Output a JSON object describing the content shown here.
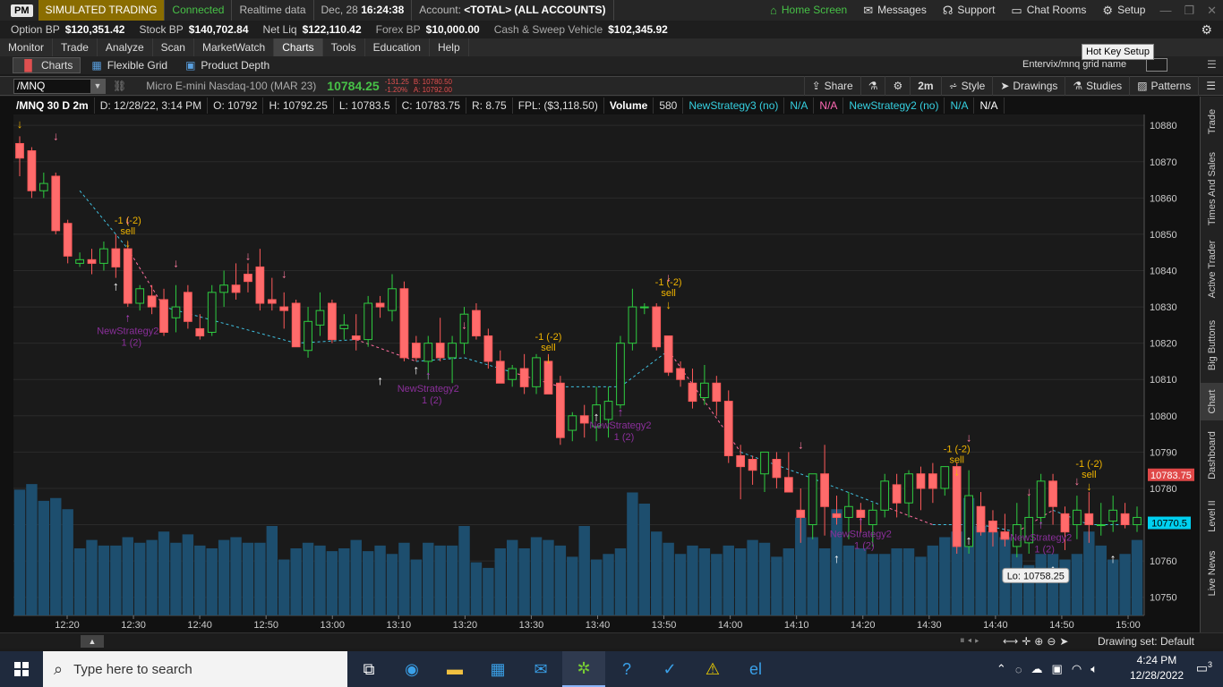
{
  "titlebar": {
    "logo": "PM",
    "mode": "SIMULATED TRADING",
    "status": "Connected",
    "data_feed": "Realtime data",
    "date": "Dec, 28",
    "time": "16:24:38",
    "account_label": "Account:",
    "account_value": "<TOTAL> (ALL ACCOUNTS)",
    "home_screen": "Home Screen",
    "messages": "Messages",
    "support": "Support",
    "chat_rooms": "Chat Rooms",
    "setup": "Setup"
  },
  "balances": [
    {
      "label": "Option BP",
      "value": "$120,351.42"
    },
    {
      "label": "Stock BP",
      "value": "$140,702.84"
    },
    {
      "label": "Net Liq",
      "value": "$122,110.42"
    },
    {
      "label": "Forex BP",
      "value": "$10,000.00"
    },
    {
      "label": "Cash & Sweep Vehicle",
      "value": "$102,345.92"
    }
  ],
  "menu": [
    "Monitor",
    "Trade",
    "Analyze",
    "Scan",
    "MarketWatch",
    "Charts",
    "Tools",
    "Education",
    "Help"
  ],
  "menu_active": "Charts",
  "subtabs": {
    "charts": "Charts",
    "flexible_grid": "Flexible Grid",
    "product_depth": "Product Depth"
  },
  "hotkey_tooltip": "Hot Key Setup",
  "grid_name": "Entervix/mnq grid name",
  "symbol": {
    "ticker": "/MNQ",
    "description": "Micro E-mini Nasdaq-100 (MAR 23)",
    "last": "10784.25",
    "change": "-131.25",
    "change_pct": "-1.20%",
    "bid": "B: 10780.50",
    "ask": "A: 10792.00"
  },
  "chart_toolbar": {
    "share": "Share",
    "timeframe": "2m",
    "style": "Style",
    "drawings": "Drawings",
    "studies": "Studies",
    "patterns": "Patterns"
  },
  "info": {
    "symbol": "/MNQ 30 D 2m",
    "date": "D: 12/28/22, 3:14 PM",
    "open": "O: 10792",
    "high": "H: 10792.25",
    "low": "L: 10783.5",
    "close": "C: 10783.75",
    "range": "R: 8.75",
    "fpl": "FPL: ($3,118.50)",
    "volume_label": "Volume",
    "volume": "580",
    "strategy3": "NewStrategy3 (no)",
    "s3_na1": "N/A",
    "s3_na2": "N/A",
    "strategy2": "NewStrategy2 (no)",
    "s2_na1": "N/A",
    "s2_na2": "N/A"
  },
  "chart_data": {
    "type": "candlestick",
    "price_ticks": [
      "10880",
      "10870",
      "10860",
      "10850",
      "10840",
      "10830",
      "10820",
      "10810",
      "10800",
      "10790",
      "10780",
      "10770",
      "10760",
      "10750"
    ],
    "time_ticks": [
      "12:20",
      "12:30",
      "12:40",
      "12:50",
      "13:00",
      "13:10",
      "13:20",
      "13:30",
      "13:40",
      "13:50",
      "14:00",
      "14:10",
      "14:20",
      "14:30",
      "14:40",
      "14:50",
      "15:00"
    ],
    "last_price_label": "10783.75",
    "cursor_price_label": "10770.5",
    "low_label": "Lo: 10758.25",
    "ylim": [
      10745,
      10883
    ],
    "signal_labels": [
      "-1 (-2)",
      "sell",
      "NewStrategy2",
      "1 (2)"
    ],
    "candles": [
      [
        10875,
        10877,
        10866,
        10871
      ],
      [
        10873,
        10874,
        10860,
        10862
      ],
      [
        10862,
        10867,
        10860,
        10864
      ],
      [
        10866,
        10867,
        10850,
        10851
      ],
      [
        10853,
        10854,
        10842,
        10844
      ],
      [
        10842,
        10845,
        10841,
        10843
      ],
      [
        10843,
        10846,
        10839,
        10842
      ],
      [
        10842,
        10848,
        10840,
        10846
      ],
      [
        10846,
        10850,
        10838,
        10841
      ],
      [
        10846,
        10848,
        10830,
        10831
      ],
      [
        10831,
        10836,
        10829,
        10835
      ],
      [
        10833,
        10836,
        10828,
        10830
      ],
      [
        10832,
        10835,
        10822,
        10823
      ],
      [
        10827,
        10836,
        10823,
        10830
      ],
      [
        10834,
        10836,
        10824,
        10826
      ],
      [
        10824,
        10828,
        10821,
        10822
      ],
      [
        10823,
        10836,
        10822,
        10834
      ],
      [
        10834,
        10840,
        10830,
        10836
      ],
      [
        10836,
        10842,
        10832,
        10834
      ],
      [
        10839,
        10842,
        10834,
        10837
      ],
      [
        10841,
        10846,
        10829,
        10831
      ],
      [
        10832,
        10838,
        10829,
        10831
      ],
      [
        10830,
        10834,
        10824,
        10829
      ],
      [
        10831,
        10832,
        10819,
        10819
      ],
      [
        10818,
        10830,
        10816,
        10826
      ],
      [
        10825,
        10834,
        10822,
        10829
      ],
      [
        10831,
        10832,
        10820,
        10821
      ],
      [
        10824,
        10828,
        10821,
        10825
      ],
      [
        10822,
        10828,
        10818,
        10821
      ],
      [
        10821,
        10833,
        10819,
        10831
      ],
      [
        10831,
        10833,
        10827,
        10830
      ],
      [
        10829,
        10839,
        10826,
        10835
      ],
      [
        10835,
        10837,
        10815,
        10816
      ],
      [
        10820,
        10822,
        10815,
        10816
      ],
      [
        10815,
        10822,
        10810,
        10820
      ],
      [
        10820,
        10827,
        10815,
        10816
      ],
      [
        10816,
        10822,
        10809,
        10820
      ],
      [
        10820,
        10830,
        10817,
        10828
      ],
      [
        10829,
        10831,
        10821,
        10822
      ],
      [
        10822,
        10824,
        10813,
        10815
      ],
      [
        10815,
        10818,
        10809,
        10809
      ],
      [
        10810,
        10814,
        10808,
        10813
      ],
      [
        10813,
        10817,
        10806,
        10808
      ],
      [
        10808,
        10817,
        10806,
        10816
      ],
      [
        10815,
        10817,
        10806,
        10806
      ],
      [
        10809,
        10811,
        10792,
        10794
      ],
      [
        10796,
        10801,
        10793,
        10800
      ],
      [
        10800,
        10803,
        10794,
        10798
      ],
      [
        10797,
        10808,
        10793,
        10803
      ],
      [
        10799,
        10808,
        10794,
        10804
      ],
      [
        10803,
        10822,
        10802,
        10820
      ],
      [
        10820,
        10835,
        10818,
        10830
      ],
      [
        10830,
        10831,
        10828,
        10830
      ],
      [
        10830,
        10831,
        10818,
        10819
      ],
      [
        10822,
        10822,
        10811,
        10812
      ],
      [
        10813,
        10815,
        10808,
        10810
      ],
      [
        10809,
        10813,
        10802,
        10804
      ],
      [
        10805,
        10814,
        10803,
        10809
      ],
      [
        10809,
        10811,
        10800,
        10804
      ],
      [
        10804,
        10807,
        10787,
        10789
      ],
      [
        10789,
        10792,
        10777,
        10786
      ],
      [
        10788,
        10789,
        10781,
        10785
      ],
      [
        10784,
        10790,
        10779,
        10790
      ],
      [
        10788,
        10790,
        10780,
        10783
      ],
      [
        10783,
        10790,
        10779,
        10779
      ],
      [
        10774,
        10780,
        10765,
        10772
      ],
      [
        10770,
        10784,
        10766,
        10784
      ],
      [
        10784,
        10792,
        10767,
        10775
      ],
      [
        10773,
        10778,
        10770,
        10772
      ],
      [
        10772,
        10779,
        10766,
        10775
      ],
      [
        10774,
        10776,
        10768,
        10772
      ],
      [
        10770,
        10776,
        10764,
        10774
      ],
      [
        10774,
        10784,
        10772,
        10782
      ],
      [
        10781,
        10784,
        10772,
        10776
      ],
      [
        10776,
        10785,
        10772,
        10784
      ],
      [
        10784,
        10786,
        10774,
        10780
      ],
      [
        10784,
        10787,
        10776,
        10780
      ],
      [
        10780,
        10786,
        10778,
        10786
      ],
      [
        10786,
        10787,
        10762,
        10764
      ],
      [
        10764,
        10785,
        10762,
        10778
      ],
      [
        10775,
        10779,
        10767,
        10768
      ],
      [
        10771,
        10774,
        10764,
        10768
      ],
      [
        10768,
        10773,
        10764,
        10766
      ],
      [
        10764,
        10776,
        10761,
        10770
      ],
      [
        10765,
        10778,
        10762,
        10772
      ],
      [
        10772,
        10784,
        10770,
        10782
      ],
      [
        10782,
        10784,
        10770,
        10775
      ],
      [
        10773,
        10775,
        10763,
        10768
      ],
      [
        10770,
        10778,
        10766,
        10774
      ],
      [
        10773,
        10779,
        10765,
        10770
      ],
      [
        10770,
        10776,
        10767,
        10770
      ],
      [
        10771,
        10778,
        10768,
        10774
      ],
      [
        10773,
        10776,
        10769,
        10770
      ],
      [
        10770,
        10775,
        10768,
        10772
      ]
    ],
    "volume": [
      45,
      47,
      41,
      42,
      38,
      24,
      27,
      25,
      25,
      28,
      26,
      27,
      30,
      26,
      29,
      25,
      24,
      27,
      28,
      26,
      26,
      32,
      20,
      24,
      26,
      25,
      23,
      24,
      27,
      23,
      25,
      22,
      26,
      20,
      26,
      25,
      25,
      32,
      19,
      17,
      24,
      27,
      24,
      28,
      27,
      25,
      21,
      32,
      20,
      22,
      24,
      44,
      40,
      30,
      26,
      22,
      25,
      24,
      22,
      25,
      24,
      27,
      26,
      21,
      24,
      35,
      28,
      24,
      38,
      25,
      24,
      22,
      22,
      24,
      24,
      21,
      25,
      28,
      30,
      42,
      32,
      30,
      28,
      22,
      18,
      22,
      22,
      20,
      22,
      30,
      25,
      20,
      22,
      27,
      30,
      23,
      48,
      20,
      20,
      28,
      25,
      55,
      25,
      28,
      56,
      70,
      25,
      30,
      35
    ]
  },
  "right_tabs": [
    "Trade",
    "Times And Sales",
    "Active Trader",
    "Big Buttons",
    "Chart",
    "Dashboard",
    "Level II",
    "Live News"
  ],
  "right_tab_active": "Chart",
  "drawing_set": "Drawing set: Default",
  "taskbar": {
    "search_placeholder": "Type here to search",
    "time": "4:24 PM",
    "date": "12/28/2022",
    "notifications": "3"
  }
}
